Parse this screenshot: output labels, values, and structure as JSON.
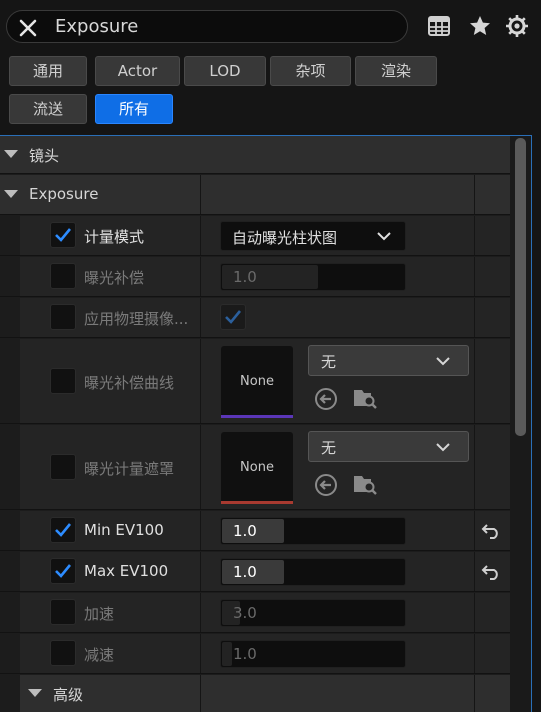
{
  "search": {
    "value": "Exposure"
  },
  "filters": [
    {
      "label": "通用",
      "active": false
    },
    {
      "label": "Actor",
      "active": false
    },
    {
      "label": "LOD",
      "active": false
    },
    {
      "label": "杂项",
      "active": false
    },
    {
      "label": "渲染",
      "active": false
    },
    {
      "label": "流送",
      "active": false
    },
    {
      "label": "所有",
      "active": true
    }
  ],
  "sections": {
    "lens": "镜头",
    "exposure": "Exposure",
    "advanced": "高级"
  },
  "properties": {
    "metering_mode": {
      "label": "计量模式",
      "checked": true,
      "value": "自动曝光柱状图"
    },
    "exposure_comp": {
      "label": "曝光补偿",
      "checked": false,
      "value": "1.0"
    },
    "apply_physical_camera": {
      "label": "应用物理摄像...",
      "checked": false,
      "value_checked": true
    },
    "comp_curve": {
      "label": "曝光补偿曲线",
      "checked": false,
      "thumb_text": "None",
      "asset": "无",
      "accent": "#6a3fcf"
    },
    "metering_mask": {
      "label": "曝光计量遮罩",
      "checked": false,
      "thumb_text": "None",
      "asset": "无",
      "accent": "#b8322e"
    },
    "min_ev100": {
      "label": "Min EV100",
      "checked": true,
      "value": "1.0",
      "fill": 0.34
    },
    "max_ev100": {
      "label": "Max EV100",
      "checked": true,
      "value": "1.0",
      "fill": 0.34
    },
    "speed_up": {
      "label": "加速",
      "checked": false,
      "value": "3.0",
      "fill": 0.1
    },
    "speed_down": {
      "label": "减速",
      "checked": false,
      "value": "1.0",
      "fill": 0.05
    }
  },
  "colors": {
    "accent": "#0f6ee6",
    "check": "#2d8cff"
  }
}
